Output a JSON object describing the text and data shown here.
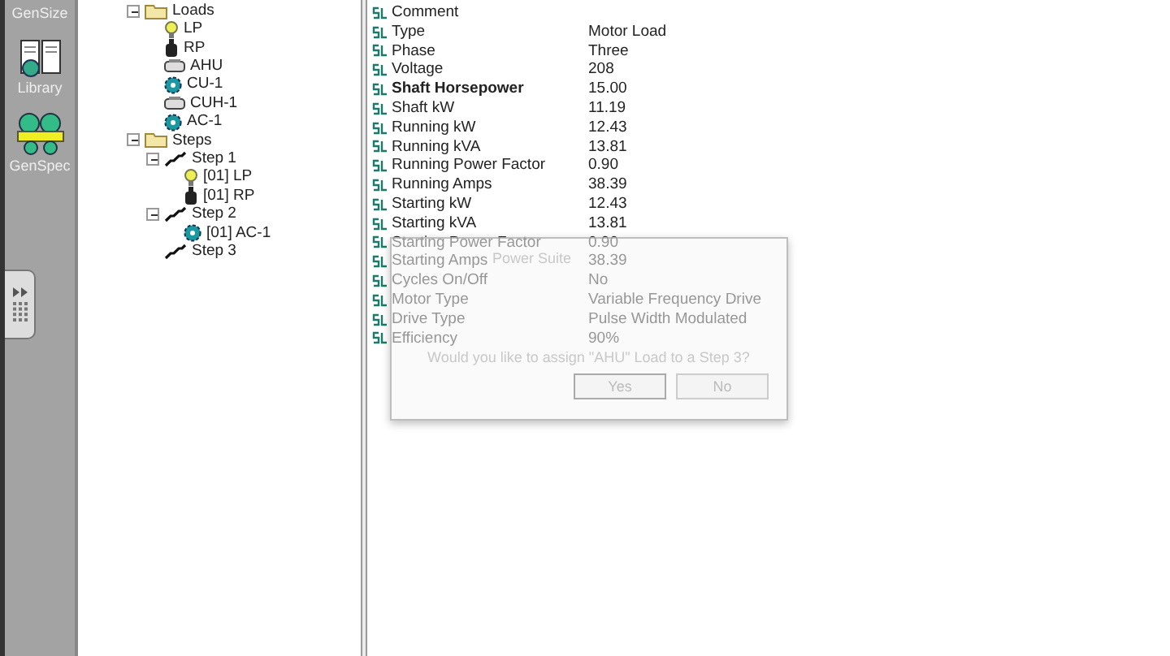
{
  "sidebar": {
    "items": [
      {
        "label": "GenSize",
        "kind": "gensize"
      },
      {
        "label": "Library",
        "kind": "library"
      },
      {
        "label": "GenSpec",
        "kind": "genspec"
      }
    ]
  },
  "tree": [
    {
      "label": "Loads",
      "kind": "folder",
      "expanded": true,
      "children": [
        {
          "label": "LP",
          "kind": "bulb"
        },
        {
          "label": "RP",
          "kind": "pump"
        },
        {
          "label": "AHU",
          "kind": "fan"
        },
        {
          "label": "CU-1",
          "kind": "gear"
        },
        {
          "label": "CUH-1",
          "kind": "fan"
        },
        {
          "label": "AC-1",
          "kind": "gear"
        }
      ]
    },
    {
      "label": "Steps",
      "kind": "folder",
      "expanded": true,
      "children": [
        {
          "label": "Step 1",
          "kind": "step",
          "expanded": true,
          "children": [
            {
              "label": "[01] LP",
              "kind": "bulb"
            },
            {
              "label": "[01] RP",
              "kind": "pump"
            }
          ]
        },
        {
          "label": "Step 2",
          "kind": "step",
          "expanded": true,
          "children": [
            {
              "label": "[01] AC-1",
              "kind": "gear"
            }
          ]
        },
        {
          "label": "Step 3",
          "kind": "step"
        }
      ]
    }
  ],
  "properties": [
    {
      "name": "Comment",
      "bold": false
    },
    {
      "name": "Type",
      "value": "Motor Load",
      "bold": false
    },
    {
      "name": "Phase",
      "value": "Three",
      "bold": false
    },
    {
      "name": "Voltage",
      "value": "208",
      "bold": false
    },
    {
      "name": "Shaft Horsepower",
      "value": "15.00",
      "bold": true
    },
    {
      "name": "Shaft kW",
      "value": "11.19",
      "bold": false
    },
    {
      "name": "Running kW",
      "value": "12.43",
      "bold": false
    },
    {
      "name": "Running kVA",
      "value": "13.81",
      "bold": false
    },
    {
      "name": "Running Power Factor",
      "value": "0.90",
      "bold": false
    },
    {
      "name": "Running Amps",
      "value": "38.39",
      "bold": false
    },
    {
      "name": "Starting kW",
      "value": "12.43",
      "bold": false
    },
    {
      "name": "Starting kVA",
      "value": "13.81",
      "bold": false
    },
    {
      "name": "Starting Power Factor",
      "value": "0.90",
      "bold": false
    },
    {
      "name": "Starting Amps",
      "value": "38.39",
      "bold": false
    },
    {
      "name": "Cycles On/Off",
      "value": "No",
      "bold": false
    },
    {
      "name": "Motor Type",
      "value": "Variable Frequency Drive",
      "bold": false
    },
    {
      "name": "Drive Type",
      "value": "Pulse Width Modulated",
      "bold": false
    },
    {
      "name": "Efficiency",
      "value": "90%",
      "bold": false
    }
  ],
  "dialog": {
    "title": "Power Suite",
    "message": "Would you like to assign \"AHU\" Load to a Step 3?",
    "buttons": [
      {
        "label": "Yes",
        "selected": true
      },
      {
        "label": "No",
        "selected": false
      }
    ]
  }
}
